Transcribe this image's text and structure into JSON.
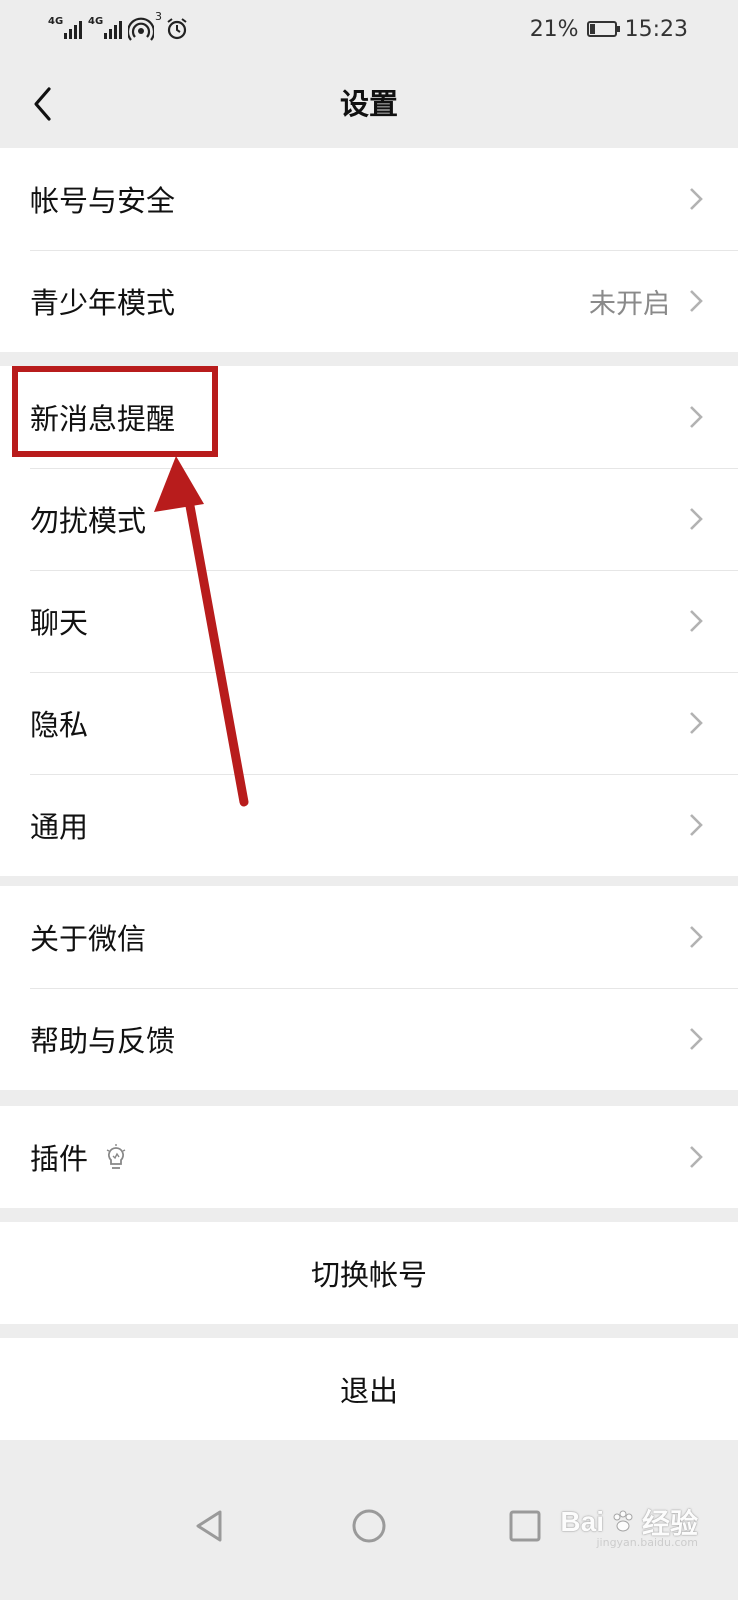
{
  "status_bar": {
    "signal1_label": "4G",
    "signal2_label": "4G",
    "notification_count": "3",
    "battery_percent": "21%",
    "battery_level": 0.21,
    "time": "15:23"
  },
  "header": {
    "title": "设置",
    "back_icon": "chevron-left-icon"
  },
  "groups": {
    "account": [
      {
        "label": "帐号与安全",
        "value": ""
      },
      {
        "label": "青少年模式",
        "value": "未开启"
      }
    ],
    "settings": [
      {
        "label": "新消息提醒"
      },
      {
        "label": "勿扰模式"
      },
      {
        "label": "聊天"
      },
      {
        "label": "隐私"
      },
      {
        "label": "通用"
      }
    ],
    "about": [
      {
        "label": "关于微信"
      },
      {
        "label": "帮助与反馈"
      }
    ],
    "plugins": [
      {
        "label": "插件",
        "icon": "lightbulb-icon"
      }
    ]
  },
  "actions": {
    "switch_account": "切换帐号",
    "logout": "退出"
  },
  "annotation": {
    "color": "#b81c1c"
  },
  "watermark": {
    "brand": "Bai",
    "brand2": "经验",
    "site": "jingyan.baidu.com"
  },
  "colors": {
    "background": "#ededed",
    "card": "#ffffff",
    "text": "#111111",
    "secondary_text": "#8a8a8a"
  }
}
